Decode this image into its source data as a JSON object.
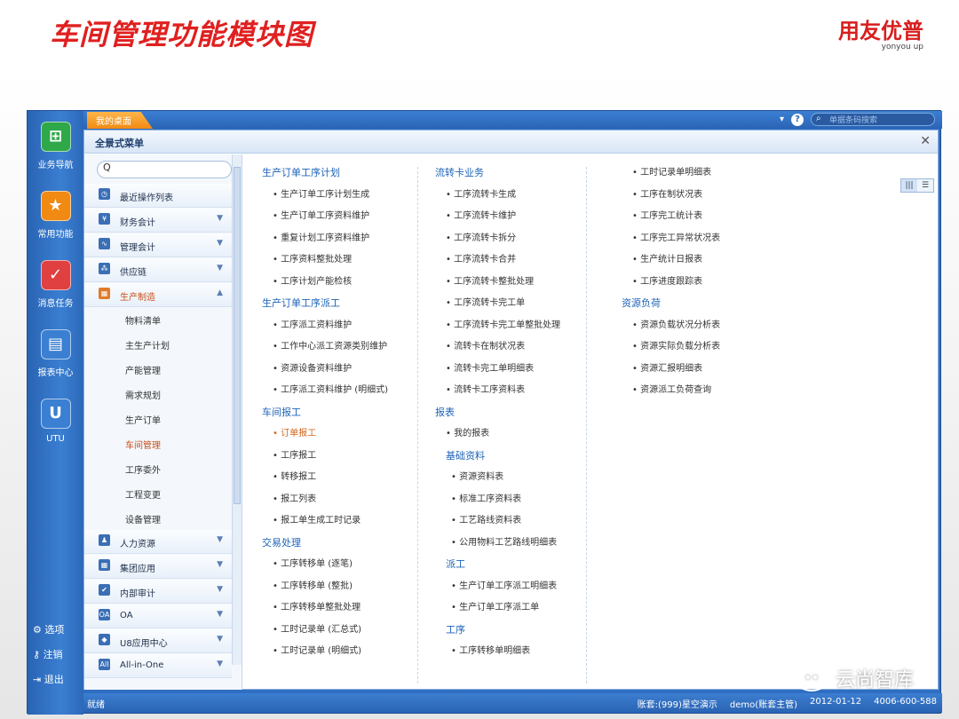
{
  "slide": {
    "title": "车间管理功能模块图",
    "brand_name": "用友优普",
    "brand_sub": "yonyou up"
  },
  "leftbar": {
    "items": [
      {
        "label": "业务导航",
        "icon": "navigation-icon",
        "color": "#2fa84a"
      },
      {
        "label": "常用功能",
        "icon": "star-icon",
        "color": "#f08a12"
      },
      {
        "label": "消息任务",
        "icon": "task-icon",
        "color": "#e04040"
      },
      {
        "label": "报表中心",
        "icon": "report-icon",
        "color": "#3a7fd2"
      },
      {
        "label": "UTU",
        "icon": "utu-icon",
        "color": "#3a7fd2"
      }
    ],
    "bottom": [
      {
        "label": "选项",
        "icon": "gear-icon"
      },
      {
        "label": "注销",
        "icon": "key-icon"
      },
      {
        "label": "退出",
        "icon": "exit-icon"
      }
    ]
  },
  "topbar": {
    "tab": "我的桌面",
    "search_placeholder": "单据条码搜索"
  },
  "panel": {
    "title": "全景式菜单",
    "search_value": "Q"
  },
  "menu": {
    "groups_top": [
      {
        "label": "最近操作列表",
        "icon": "clock-icon",
        "glyph": "◷"
      },
      {
        "label": "财务会计",
        "icon": "yen-icon",
        "glyph": "¥"
      },
      {
        "label": "管理会计",
        "icon": "chart-icon",
        "glyph": "∿"
      },
      {
        "label": "供应链",
        "icon": "supply-chain-icon",
        "glyph": "⁂"
      },
      {
        "label": "生产制造",
        "icon": "factory-icon",
        "glyph": "▦",
        "active": true
      }
    ],
    "sub_items": [
      "物料清单",
      "主生产计划",
      "产能管理",
      "需求规划",
      "生产订单",
      "车间管理",
      "工序委外",
      "工程变更",
      "设备管理"
    ],
    "selected_sub": "车间管理",
    "groups_bottom": [
      {
        "label": "人力资源",
        "icon": "person-icon",
        "glyph": "♟"
      },
      {
        "label": "集团应用",
        "icon": "group-icon",
        "glyph": "▦"
      },
      {
        "label": "内部审计",
        "icon": "audit-icon",
        "glyph": "✔"
      },
      {
        "label": "OA",
        "icon": "oa-icon",
        "glyph": "OA"
      },
      {
        "label": "U8应用中心",
        "icon": "cube-icon",
        "glyph": "◆"
      },
      {
        "label": "All-in-One",
        "icon": "all-in-one-icon",
        "glyph": "All"
      }
    ]
  },
  "columns": [
    [
      {
        "t": "sec",
        "text": "生产订单工序计划"
      },
      {
        "t": "it",
        "text": "• 生产订单工序计划生成"
      },
      {
        "t": "it",
        "text": "• 生产订单工序资料维护"
      },
      {
        "t": "it",
        "text": "• 重复计划工序资料维护"
      },
      {
        "t": "it",
        "text": "• 工序资料整批处理"
      },
      {
        "t": "it",
        "text": "• 工序计划产能检核"
      },
      {
        "t": "sec",
        "text": "生产订单工序派工"
      },
      {
        "t": "it",
        "text": "• 工序派工资料维护"
      },
      {
        "t": "it",
        "text": "• 工作中心派工资源类别维护"
      },
      {
        "t": "it",
        "text": "• 资源设备资料维护"
      },
      {
        "t": "it",
        "text": "• 工序派工资料维护 (明细式)"
      },
      {
        "t": "sec",
        "text": "车间报工"
      },
      {
        "t": "it",
        "text": "• 订单报工",
        "orange": true
      },
      {
        "t": "it",
        "text": "• 工序报工"
      },
      {
        "t": "it",
        "text": "• 转移报工"
      },
      {
        "t": "it",
        "text": "• 报工列表"
      },
      {
        "t": "it",
        "text": "• 报工单生成工时记录"
      },
      {
        "t": "sec",
        "text": "交易处理"
      },
      {
        "t": "it",
        "text": "• 工序转移单 (逐笔)"
      },
      {
        "t": "it",
        "text": "• 工序转移单 (整批)"
      },
      {
        "t": "it",
        "text": "• 工序转移单整批处理"
      },
      {
        "t": "it",
        "text": "• 工时记录单 (汇总式)"
      },
      {
        "t": "it",
        "text": "• 工时记录单 (明细式)"
      }
    ],
    [
      {
        "t": "sec",
        "text": "流转卡业务"
      },
      {
        "t": "it",
        "text": "• 工序流转卡生成"
      },
      {
        "t": "it",
        "text": "• 工序流转卡维护"
      },
      {
        "t": "it",
        "text": "• 工序流转卡拆分"
      },
      {
        "t": "it",
        "text": "• 工序流转卡合并"
      },
      {
        "t": "it",
        "text": "• 工序流转卡整批处理"
      },
      {
        "t": "it",
        "text": "• 工序流转卡完工单"
      },
      {
        "t": "it",
        "text": "• 工序流转卡完工单整批处理"
      },
      {
        "t": "it",
        "text": "• 流转卡在制状况表"
      },
      {
        "t": "it",
        "text": "• 流转卡完工单明细表"
      },
      {
        "t": "it",
        "text": "• 流转卡工序资料表"
      },
      {
        "t": "sec",
        "text": "报表"
      },
      {
        "t": "it",
        "text": "• 我的报表"
      },
      {
        "t": "sec",
        "text": "基础资料",
        "inner": true
      },
      {
        "t": "it",
        "text": "• 资源资料表",
        "sub": true
      },
      {
        "t": "it",
        "text": "• 标准工序资料表",
        "sub": true
      },
      {
        "t": "it",
        "text": "• 工艺路线资料表",
        "sub": true
      },
      {
        "t": "it",
        "text": "• 公用物料工艺路线明细表",
        "sub": true
      },
      {
        "t": "sec",
        "text": "派工",
        "inner": true
      },
      {
        "t": "it",
        "text": "• 生产订单工序派工明细表",
        "sub": true
      },
      {
        "t": "it",
        "text": "• 生产订单工序派工单",
        "sub": true
      },
      {
        "t": "sec",
        "text": "工序",
        "inner": true
      },
      {
        "t": "it",
        "text": "• 工序转移单明细表",
        "sub": true
      }
    ],
    [
      {
        "t": "it",
        "text": "• 工时记录单明细表"
      },
      {
        "t": "it",
        "text": "• 工序在制状况表"
      },
      {
        "t": "it",
        "text": "• 工序完工统计表"
      },
      {
        "t": "it",
        "text": "• 工序完工异常状况表"
      },
      {
        "t": "it",
        "text": "• 生产统计日报表"
      },
      {
        "t": "it",
        "text": "• 工序进度跟踪表"
      },
      {
        "t": "sec",
        "text": "资源负荷"
      },
      {
        "t": "it",
        "text": "• 资源负载状况分析表"
      },
      {
        "t": "it",
        "text": "• 资源实际负载分析表"
      },
      {
        "t": "it",
        "text": "• 资源汇报明细表"
      },
      {
        "t": "it",
        "text": "• 资源派工负荷查询"
      }
    ]
  ],
  "status": {
    "left": "就绪",
    "account": "账套:(999)星空演示",
    "user": "demo(账套主管)",
    "date": "2012-01-12",
    "phone": "4006-600-588"
  },
  "watermark": {
    "text": "云尚智库"
  }
}
